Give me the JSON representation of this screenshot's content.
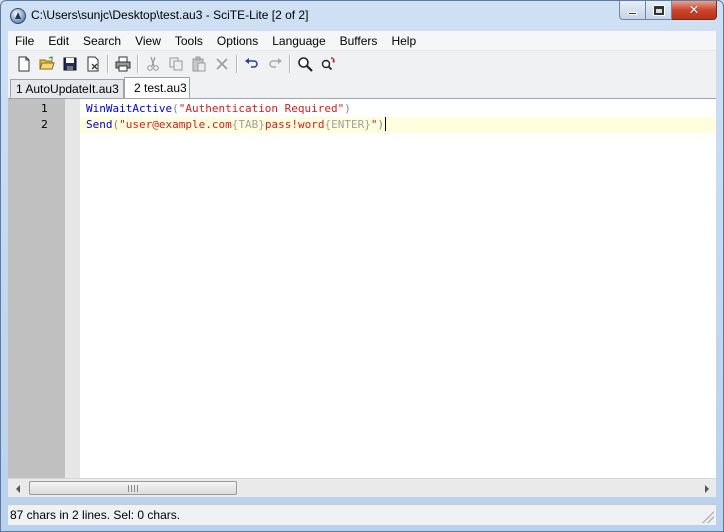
{
  "window": {
    "title": "C:\\Users\\sunjc\\Desktop\\test.au3 - SciTE-Lite [2 of 2]",
    "close_glyph": "✕"
  },
  "menu": [
    "File",
    "Edit",
    "Search",
    "View",
    "Tools",
    "Options",
    "Language",
    "Buffers",
    "Help"
  ],
  "toolbar": {
    "icons": [
      "new-file-icon",
      "open-folder-icon",
      "save-icon",
      "close-file-icon",
      "print-icon",
      "cut-icon",
      "copy-icon",
      "paste-icon",
      "delete-icon",
      "undo-icon",
      "redo-icon",
      "find-icon",
      "replace-icon"
    ]
  },
  "tabs": [
    {
      "label": "1 AutoUpdateIt.au3",
      "active": false
    },
    {
      "label": "2 test.au3",
      "active": true
    }
  ],
  "editor": {
    "lines": [
      {
        "number": "1",
        "fn": "WinWaitActive",
        "open": "(",
        "arg": "\"Authentication Required\"",
        "close": ")"
      },
      {
        "number": "2",
        "fn": "Send",
        "open": "(",
        "arg1": "\"user@example.com",
        "tok1": "{TAB}",
        "arg2": "pass!word",
        "tok2": "{ENTER}",
        "arg3": "\"",
        "close": ")"
      }
    ]
  },
  "status": {
    "text": "87 chars in 2 lines. Sel: 0 chars."
  },
  "colors": {
    "function": "#0000cc",
    "string": "#cc2020",
    "send_key": "#a0a0a0",
    "caret_line": "#ffffe0",
    "gutter": "#c0c0c0"
  }
}
